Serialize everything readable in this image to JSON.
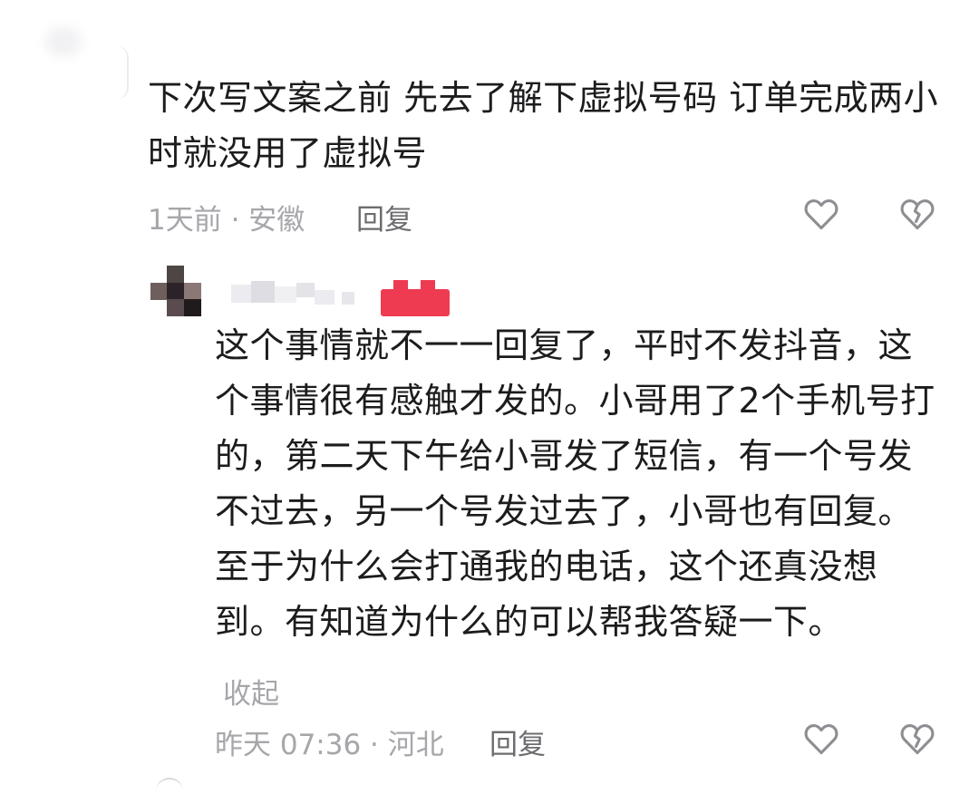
{
  "comment_top": {
    "text": "下次写文案之前 先去了解下虚拟号码 订单完成两小时就没用了虚拟号",
    "time_location": "1天前 · 安徽",
    "reply_label": "回复"
  },
  "comment_reply": {
    "text": "这个事情就不一一回复了，平时不发抖音，这个事情很有感触才发的。小哥用了2个手机号打的，第二天下午给小哥发了短信，有一个号发不过去，另一个号发过去了，小哥也有回复。至于为什么会打通我的电话，这个还真没想到。有知道为什么的可以帮我答疑一下。",
    "collapse_label": "收起",
    "time_location": "昨天 07:36 · 河北",
    "reply_label": "回复"
  },
  "icons": [
    "heart-outline-icon",
    "broken-heart-icon"
  ],
  "colors": {
    "text": "#1c1c1e",
    "meta": "#a6a6ab",
    "reply": "#6c6c70",
    "icon_stroke": "#8e8e93",
    "badge_red": "#ee3b52"
  }
}
